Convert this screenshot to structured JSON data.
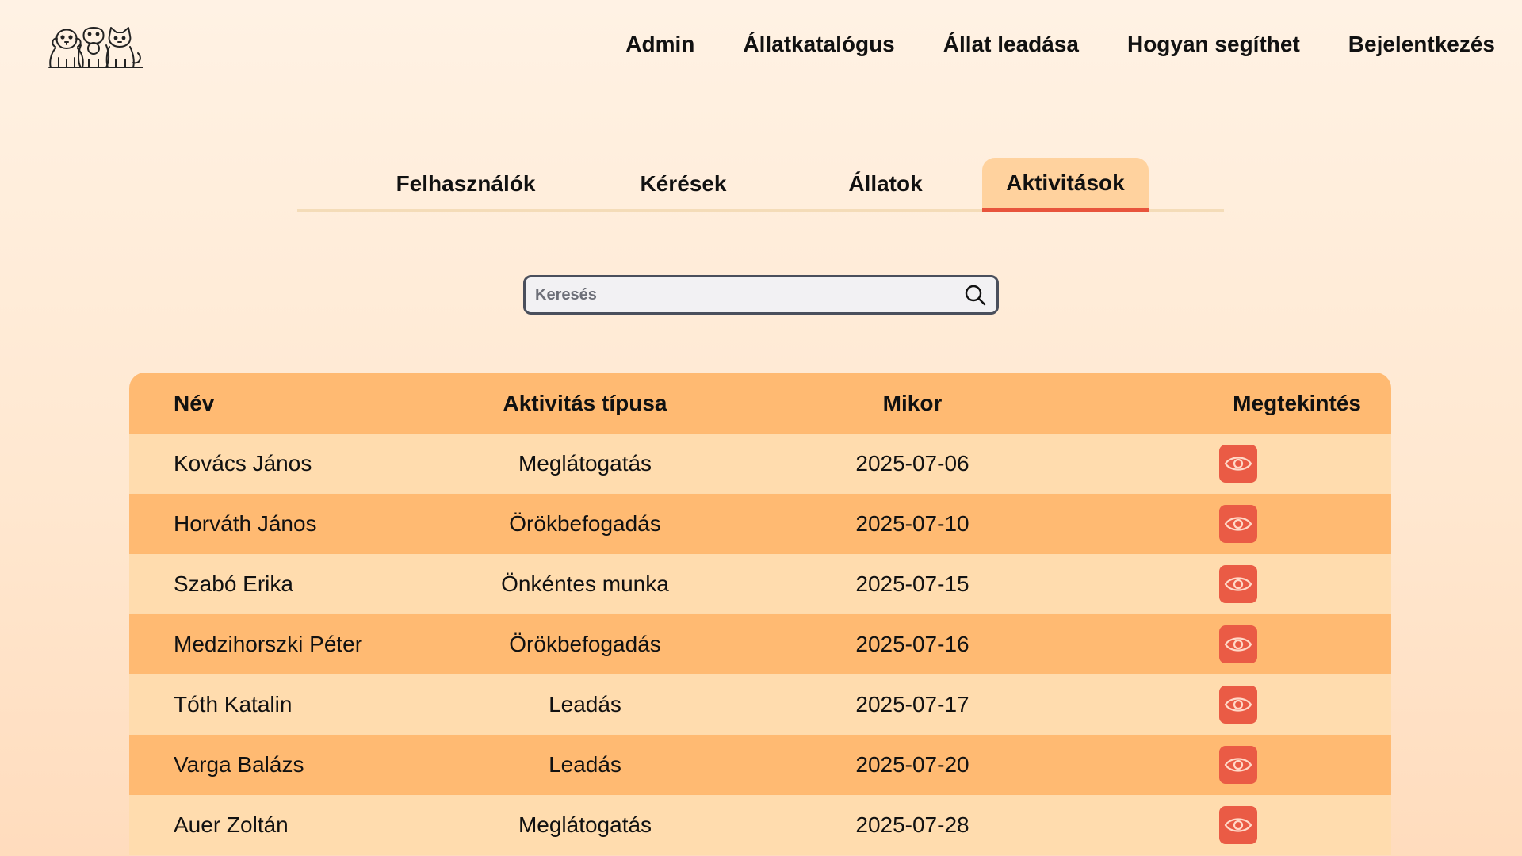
{
  "nav": {
    "items": [
      "Admin",
      "Állatkatalógus",
      "Állat leadása",
      "Hogyan segíthet",
      "Bejelentkezés"
    ]
  },
  "tabs": [
    {
      "label": "Felhasználók"
    },
    {
      "label": "Kérések"
    },
    {
      "label": "Állatok"
    },
    {
      "label": "Aktivitások",
      "active": true
    }
  ],
  "search": {
    "placeholder": "Keresés"
  },
  "table": {
    "headers": [
      "Név",
      "Aktivitás típusa",
      "Mikor",
      "Megtekintés"
    ],
    "rows": [
      {
        "name": "Kovács János",
        "type": "Meglátogatás",
        "date": "2025-07-06"
      },
      {
        "name": "Horváth János",
        "type": "Örökbefogadás",
        "date": "2025-07-10"
      },
      {
        "name": "Szabó Erika",
        "type": "Önkéntes munka",
        "date": "2025-07-15"
      },
      {
        "name": "Medzihorszki Péter",
        "type": "Örökbefogadás",
        "date": "2025-07-16"
      },
      {
        "name": "Tóth Katalin",
        "type": "Leadás",
        "date": "2025-07-17"
      },
      {
        "name": "Varga Balázs",
        "type": "Leadás",
        "date": "2025-07-20"
      },
      {
        "name": "Auer Zoltán",
        "type": "Meglátogatás",
        "date": "2025-07-28"
      }
    ]
  },
  "icons": {
    "logo": "dog-cat-logo-icon",
    "search": "search-icon",
    "view": "eye-icon"
  },
  "colors": {
    "accent": "#ea5b45",
    "row_dark": "#ffba72",
    "row_light": "#ffdcae",
    "tab_active": "#ffd29e"
  }
}
